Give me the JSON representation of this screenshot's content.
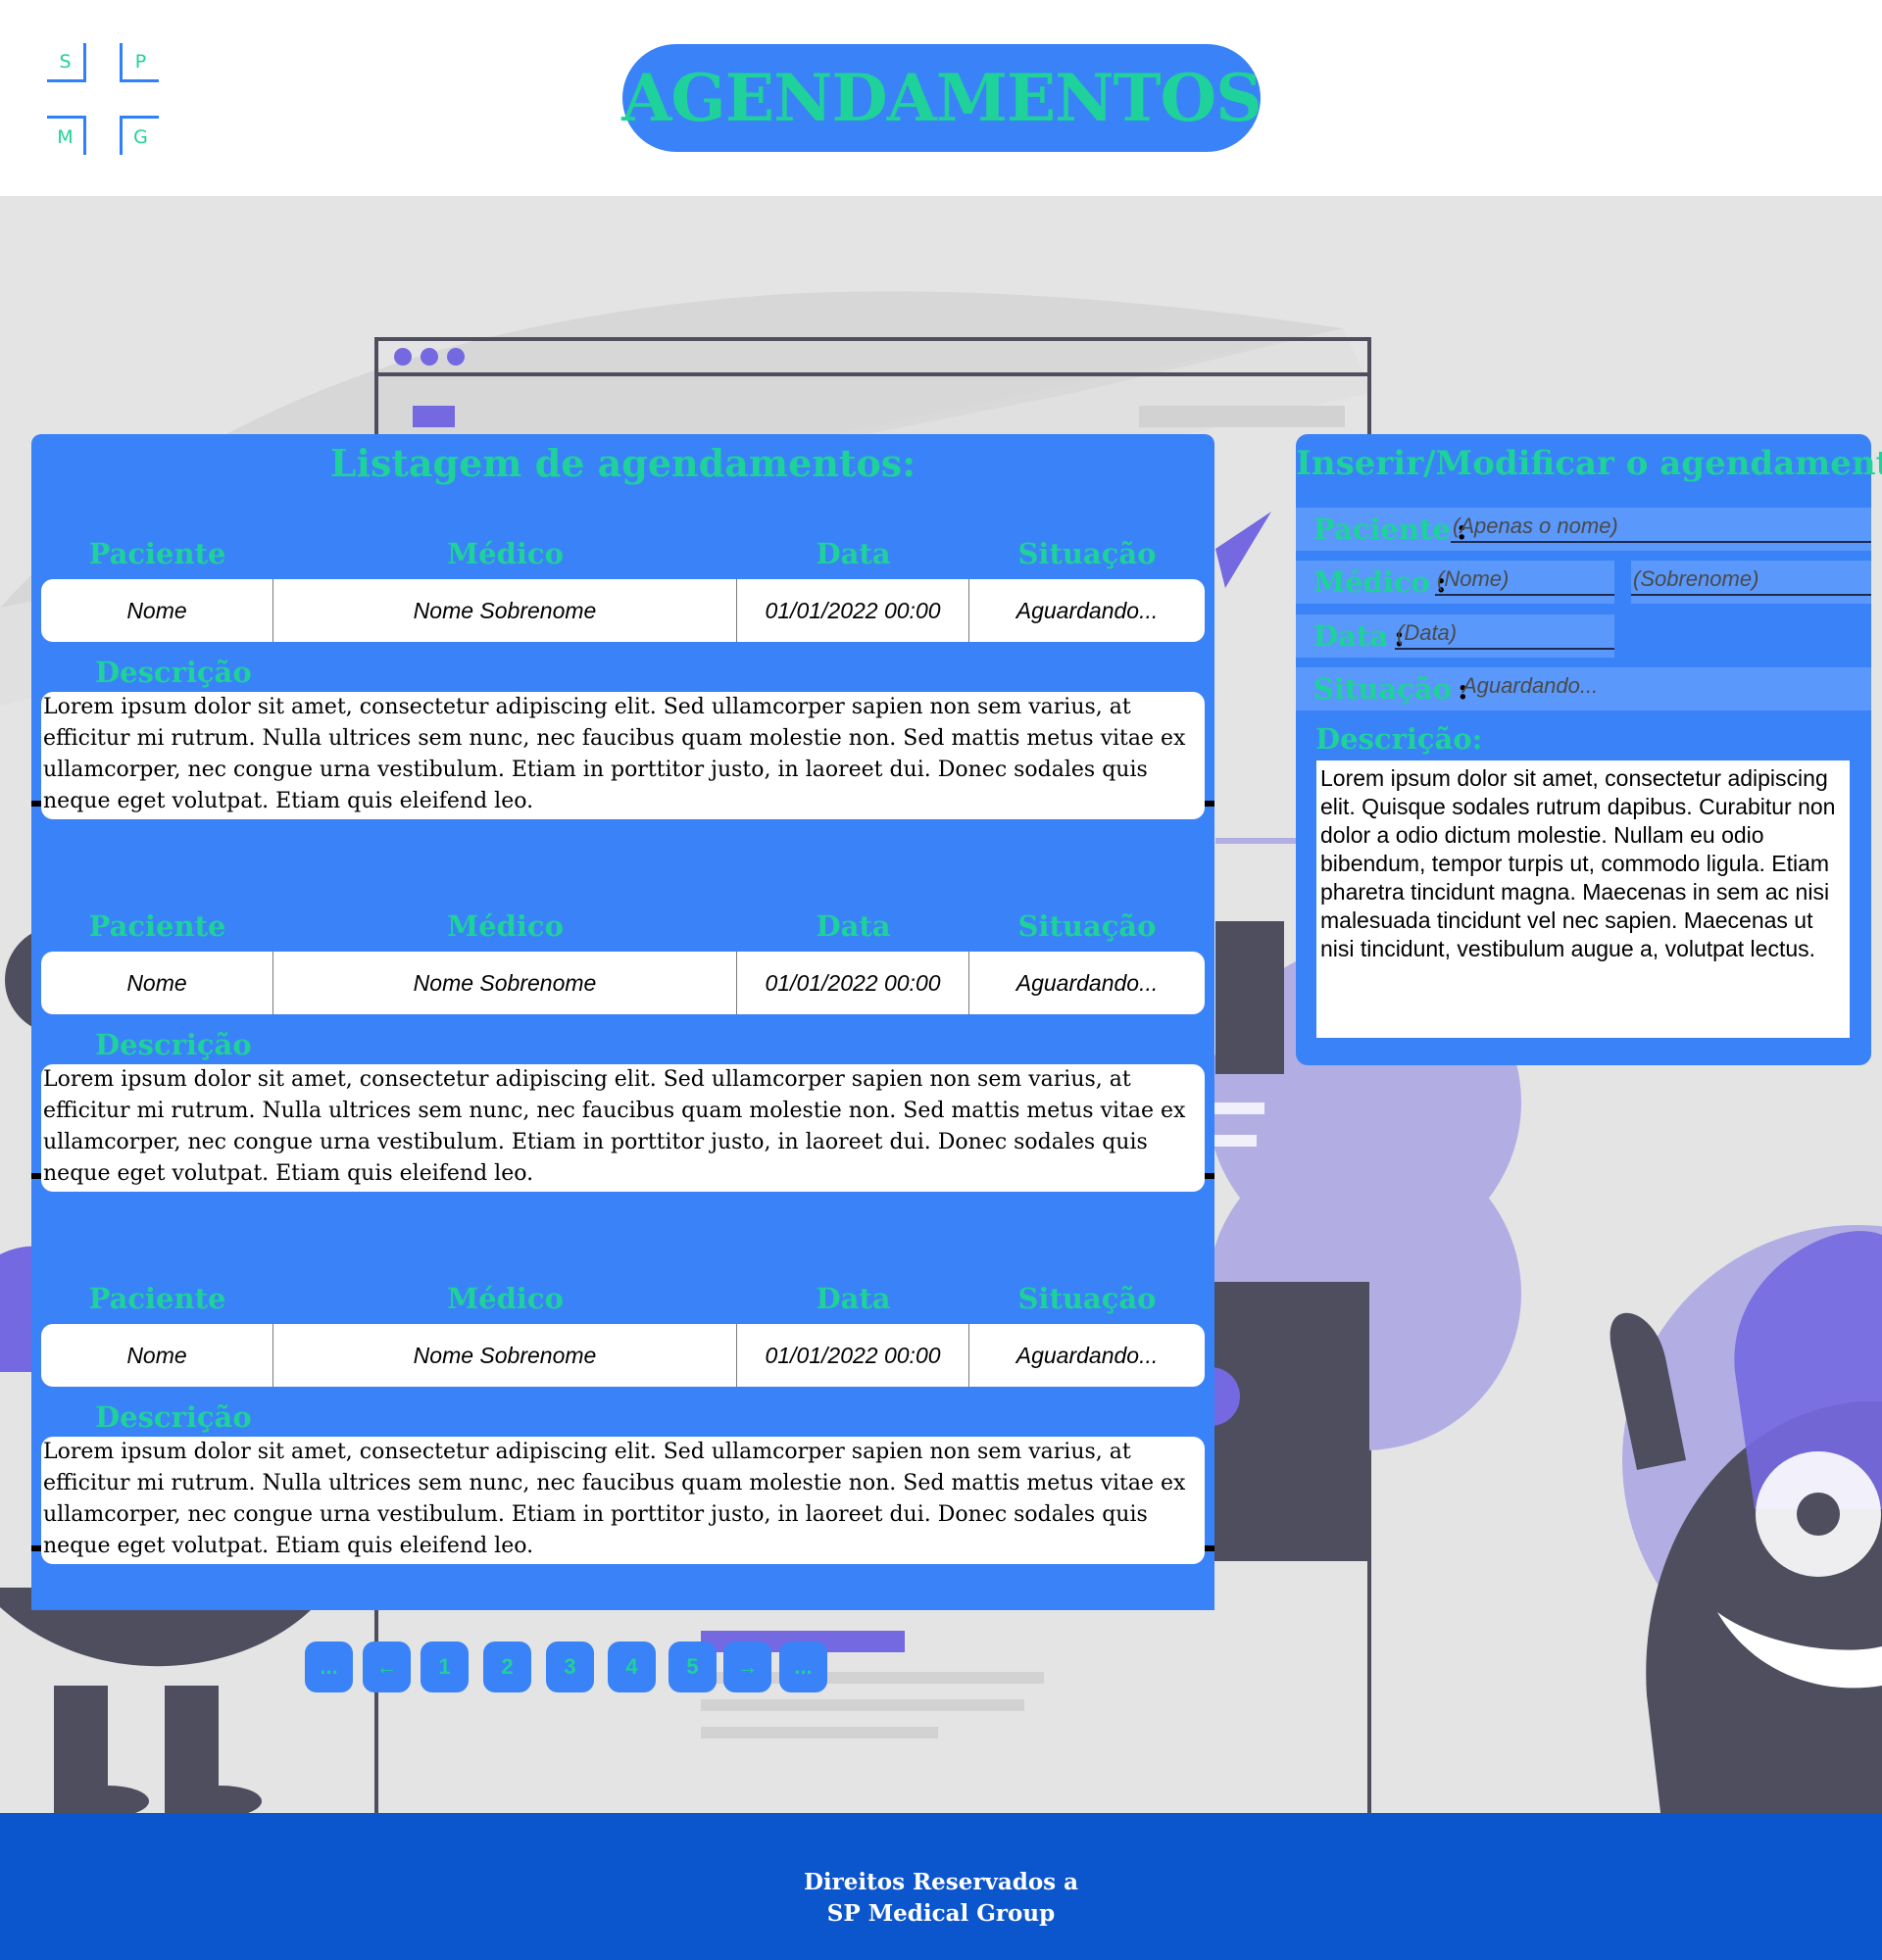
{
  "logo": {
    "letters": [
      "S",
      "P",
      "M",
      "G"
    ]
  },
  "header": {
    "title": "AGENDAMENTOS"
  },
  "listing": {
    "title": "Listagem de agendamentos:",
    "columns": [
      "Paciente",
      "Médico",
      "Data",
      "Situação"
    ],
    "description_label": "Descrição",
    "records": [
      {
        "paciente": "Nome",
        "medico": "Nome Sobrenome",
        "data": "01/01/2022 00:00",
        "situacao": "Aguardando...",
        "descricao": "Lorem ipsum dolor sit amet, consectetur adipiscing elit. Sed ullamcorper sapien non sem varius, at efficitur mi rutrum. Nulla ultrices sem nunc, nec faucibus quam molestie non. Sed mattis metus vitae ex ullamcorper, nec congue urna vestibulum. Etiam in porttitor justo, in laoreet dui. Donec sodales quis neque eget volutpat. Etiam quis eleifend leo."
      },
      {
        "paciente": "Nome",
        "medico": "Nome Sobrenome",
        "data": "01/01/2022 00:00",
        "situacao": "Aguardando...",
        "descricao": "Lorem ipsum dolor sit amet, consectetur adipiscing elit. Sed ullamcorper sapien non sem varius, at efficitur mi rutrum. Nulla ultrices sem nunc, nec faucibus quam molestie non. Sed mattis metus vitae ex ullamcorper, nec congue urna vestibulum. Etiam in porttitor justo, in laoreet dui. Donec sodales quis neque eget volutpat. Etiam quis eleifend leo."
      },
      {
        "paciente": "Nome",
        "medico": "Nome Sobrenome",
        "data": "01/01/2022 00:00",
        "situacao": "Aguardando...",
        "descricao": "Lorem ipsum dolor sit amet, consectetur adipiscing elit. Sed ullamcorper sapien non sem varius, at efficitur mi rutrum. Nulla ultrices sem nunc, nec faucibus quam molestie non. Sed mattis metus vitae ex ullamcorper, nec congue urna vestibulum. Etiam in porttitor justo, in laoreet dui. Donec sodales quis neque eget volutpat. Etiam quis eleifend leo."
      }
    ]
  },
  "pagination": {
    "items": [
      "...",
      "←",
      "1",
      "2",
      "3",
      "4",
      "5",
      "→",
      "..."
    ]
  },
  "form": {
    "title": "Inserir/Modificar o agendamento:",
    "paciente_label": "Paciente",
    "paciente_placeholder": "(Apenas o nome)",
    "medico_label": "Médico",
    "medico_nome_placeholder": "(Nome)",
    "medico_sobrenome_placeholder": "(Sobrenome)",
    "data_label": "Data",
    "data_placeholder": "(Data)",
    "situacao_label": "Situação",
    "situacao_value": "Aguardando...",
    "colon": ":",
    "descricao_label": "Descrição:",
    "descricao_value": "Lorem ipsum dolor sit amet, consectetur adipiscing elit. Quisque sodales rutrum dapibus. Curabitur non dolor a odio dictum molestie. Nullam eu odio bibendum, tempor turpis ut, commodo ligula. Etiam pharetra tincidunt magna. Maecenas in sem ac nisi malesuada tincidunt vel nec sapien. Maecenas ut nisi tincidunt, vestibulum augue a, volutpat lectus."
  },
  "footer": {
    "line1": "Direitos Reservados a",
    "line2": "SP Medical Group"
  },
  "colors": {
    "accent_blue": "#3a82f8",
    "accent_green": "#1fd19a",
    "footer_blue": "#0b56cc",
    "background": "#e4e4e4",
    "illustration_purple": "#7469e0",
    "illustration_dark": "#4f4e5e"
  }
}
